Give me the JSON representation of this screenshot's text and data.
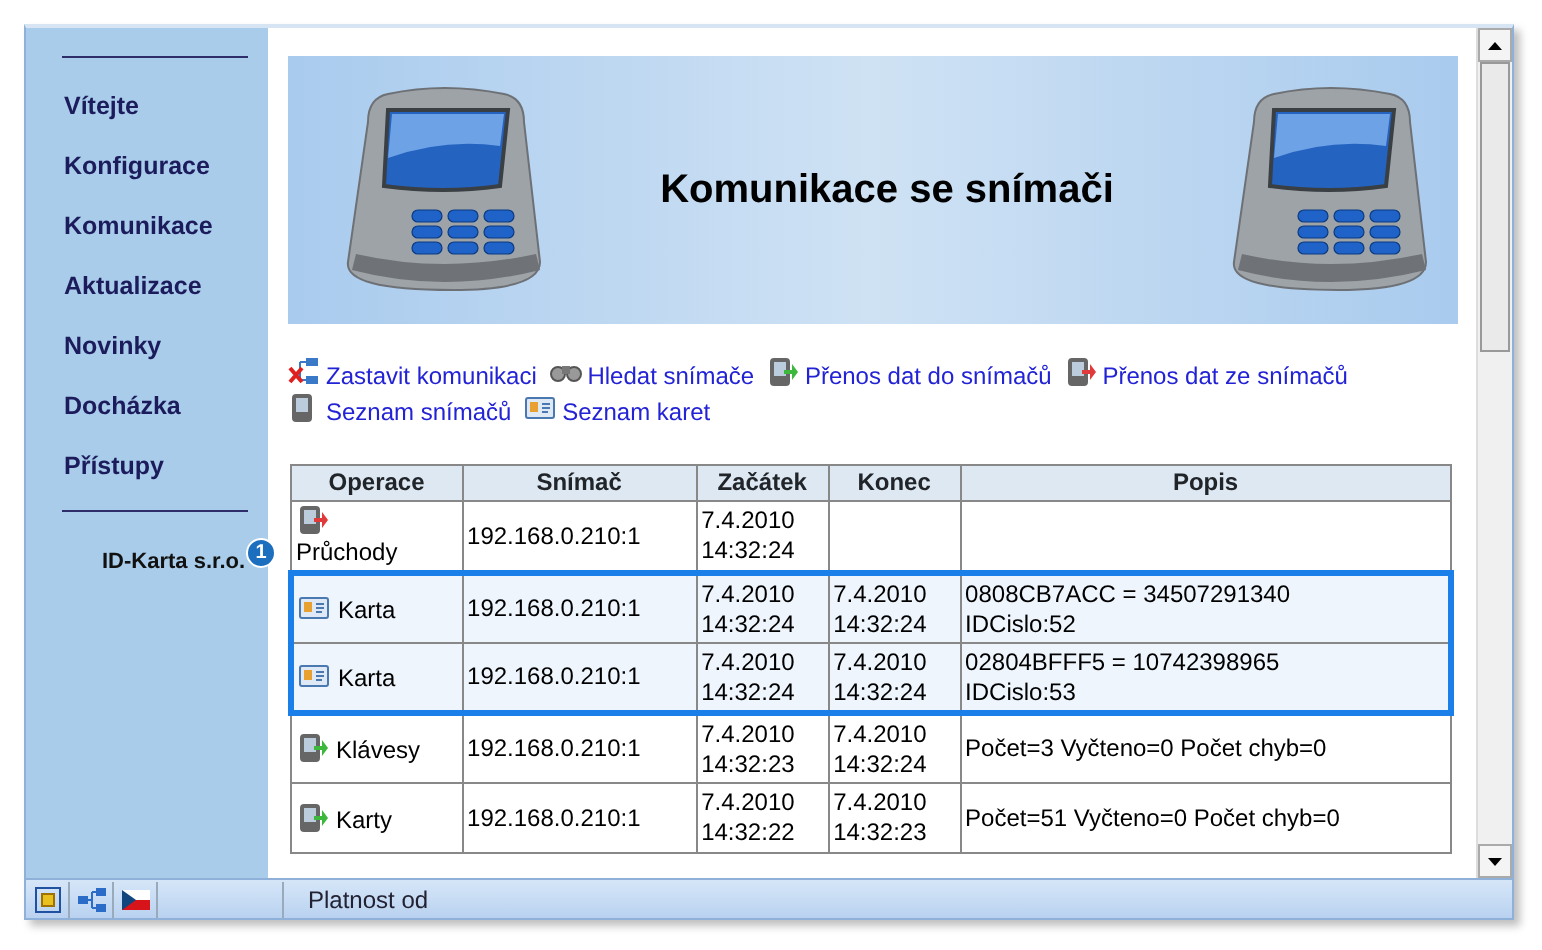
{
  "sidebar": {
    "items": [
      {
        "label": "Vítejte"
      },
      {
        "label": "Konfigurace"
      },
      {
        "label": "Komunikace"
      },
      {
        "label": "Aktualizace"
      },
      {
        "label": "Novinky"
      },
      {
        "label": "Docházka"
      },
      {
        "label": "Přístupy"
      }
    ],
    "company": "ID-Karta s.r.o.",
    "badge": "1"
  },
  "banner": {
    "title": "Komunikace se snímači"
  },
  "actions": [
    {
      "kind": "stop",
      "label": "Zastavit komunikaci"
    },
    {
      "kind": "find",
      "label": "Hledat snímače"
    },
    {
      "kind": "send",
      "label": "Přenos dat do snímačů"
    },
    {
      "kind": "receive",
      "label": "Přenos dat ze snímačů"
    },
    {
      "kind": "reader",
      "label": "Seznam snímačů"
    },
    {
      "kind": "card",
      "label": "Seznam karet"
    }
  ],
  "table": {
    "columns": [
      "Operace",
      "Snímač",
      "Začátek",
      "Konec",
      "Popis"
    ],
    "rows": [
      {
        "kind": "receive",
        "operation": "Průchody",
        "reader": "192.168.0.210:1",
        "start": [
          "7.4.2010",
          "14:32:24"
        ],
        "end": [],
        "description": [],
        "selected": false
      },
      {
        "kind": "card",
        "operation": "Karta",
        "reader": "192.168.0.210:1",
        "start": [
          "7.4.2010",
          "14:32:24"
        ],
        "end": [
          "7.4.2010",
          "14:32:24"
        ],
        "description": [
          "0808CB7ACC = 34507291340",
          "IDCislo:52"
        ],
        "selected": true
      },
      {
        "kind": "card",
        "operation": "Karta",
        "reader": "192.168.0.210:1",
        "start": [
          "7.4.2010",
          "14:32:24"
        ],
        "end": [
          "7.4.2010",
          "14:32:24"
        ],
        "description": [
          "02804BFFF5 = 10742398965",
          "IDCislo:53"
        ],
        "selected": true
      },
      {
        "kind": "send",
        "operation": "Klávesy",
        "reader": "192.168.0.210:1",
        "start": [
          "7.4.2010",
          "14:32:23"
        ],
        "end": [
          "7.4.2010",
          "14:32:24"
        ],
        "description": [
          "Počet=3 Vyčteno=0 Počet chyb=0"
        ],
        "selected": false
      },
      {
        "kind": "send",
        "operation": "Karty",
        "reader": "192.168.0.210:1",
        "start": [
          "7.4.2010",
          "14:32:22"
        ],
        "end": [
          "7.4.2010",
          "14:32:23"
        ],
        "description": [
          "Počet=51 Vyčteno=0 Počet chyb=0"
        ],
        "selected": false
      }
    ]
  },
  "status_bar": {
    "text": "Platnost od"
  }
}
